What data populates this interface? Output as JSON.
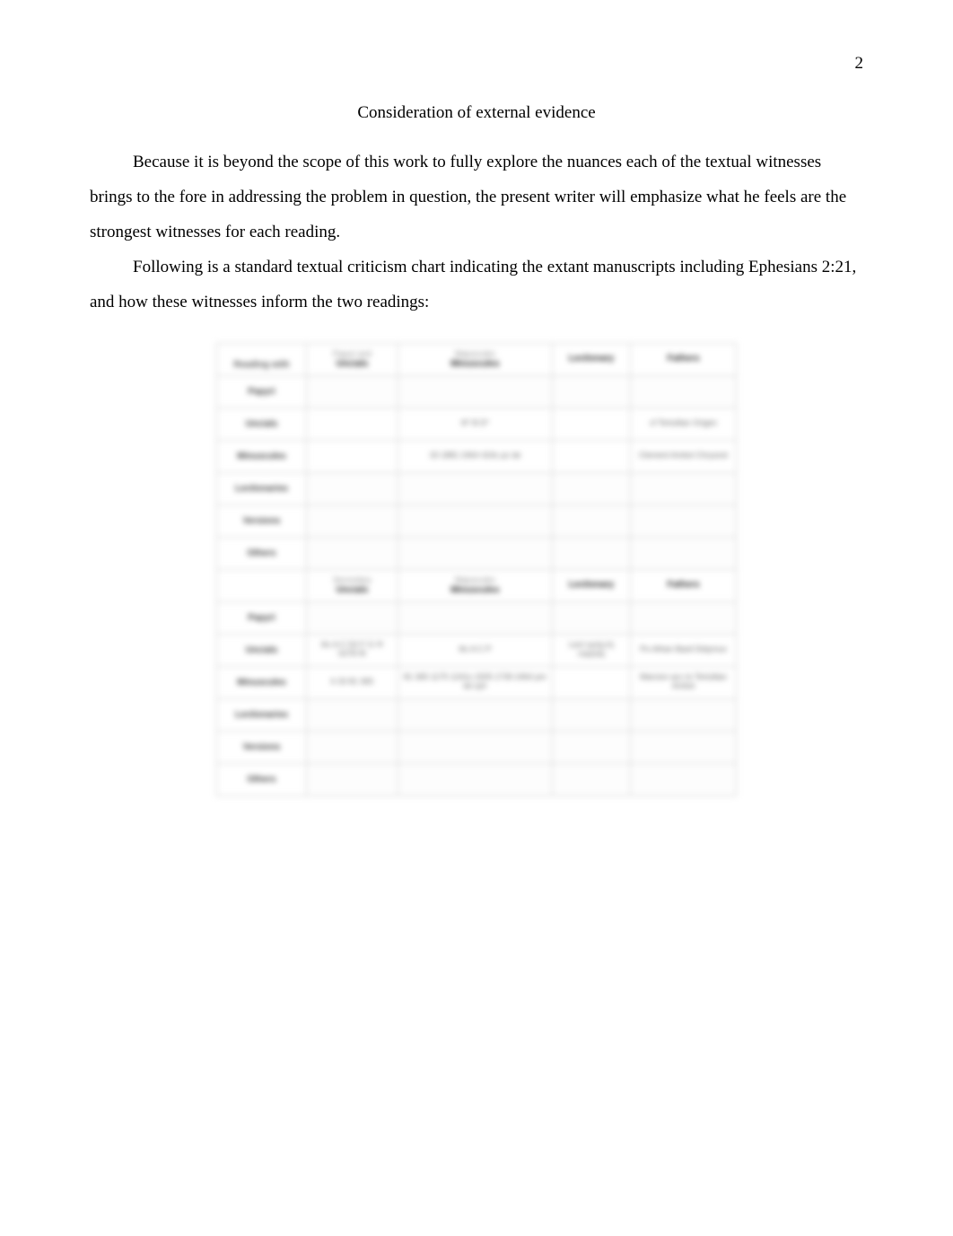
{
  "pageNumber": "2",
  "heading": "Consideration of external evidence",
  "paragraph1": "Because it is beyond the scope of this work to fully explore the nuances each of the textual witnesses brings to the fore in addressing the problem in question, the present writer will emphasize what he feels are the strongest witnesses for each reading.",
  "paragraph2": "Following is a standard textual criticism chart indicating the extant manuscripts including Ephesians 2:21, and how these witnesses inform the two readings:",
  "chart": {
    "section1": {
      "topLeft": "Reading with",
      "headers": {
        "col1_top": "Papyri and",
        "col1_bottom": "Uncials",
        "col2_top": "Majuscules",
        "col2_bottom": "Minuscules",
        "col3": "Lectionary",
        "col4": "Fathers"
      },
      "rows": [
        {
          "label": "Papyri",
          "c1": "",
          "c2": "",
          "c3": "",
          "c4": ""
        },
        {
          "label": "Uncials",
          "c1": "",
          "c2": "ℵ* B D*",
          "c3": "",
          "c4": "cf Tertullian Origen"
        },
        {
          "label": "Minuscules",
          "c1": "",
          "c2": "33 1881 2464 424c pc lat",
          "c3": "",
          "c4": "Clement Ambst Chrysost"
        },
        {
          "label": "Lectionaries",
          "c1": "",
          "c2": "",
          "c3": "",
          "c4": ""
        },
        {
          "label": "Versions",
          "c1": "",
          "c2": "",
          "c3": "",
          "c4": ""
        },
        {
          "label": "Others",
          "c1": "",
          "c2": "",
          "c3": "",
          "c4": ""
        }
      ]
    },
    "section2": {
      "headers": {
        "col1_top": "Secondary",
        "col1_bottom": "Uncials",
        "col2_top": "Majuscules",
        "col2_bottom": "Minuscules",
        "col3": "Lectionary",
        "col4": "Fathers"
      },
      "rows": [
        {
          "label": "Papyri",
          "c1": "",
          "c2": "",
          "c3": "",
          "c4": ""
        },
        {
          "label": "Uncials",
          "c1": "ℵc A C D2 F G Ψ 0278 𝔐",
          "c2": "ℵc A C P",
          "c3": "Lect syr(p,h) cop(sa)",
          "c4": "Ps-Athan Basil Didymus"
        },
        {
          "label": "Minuscules",
          "c1": "6 33 81 365",
          "c2": "81 365 1175 1241s 1505 1739 2464 pm lat syh",
          "c3": "",
          "c4": "Marcion acc to Tertullian Ambst"
        },
        {
          "label": "Lectionaries",
          "c1": "",
          "c2": "",
          "c3": "",
          "c4": ""
        },
        {
          "label": "Versions",
          "c1": "",
          "c2": "",
          "c3": "",
          "c4": ""
        },
        {
          "label": "Others",
          "c1": "",
          "c2": "",
          "c3": "",
          "c4": ""
        }
      ]
    }
  }
}
